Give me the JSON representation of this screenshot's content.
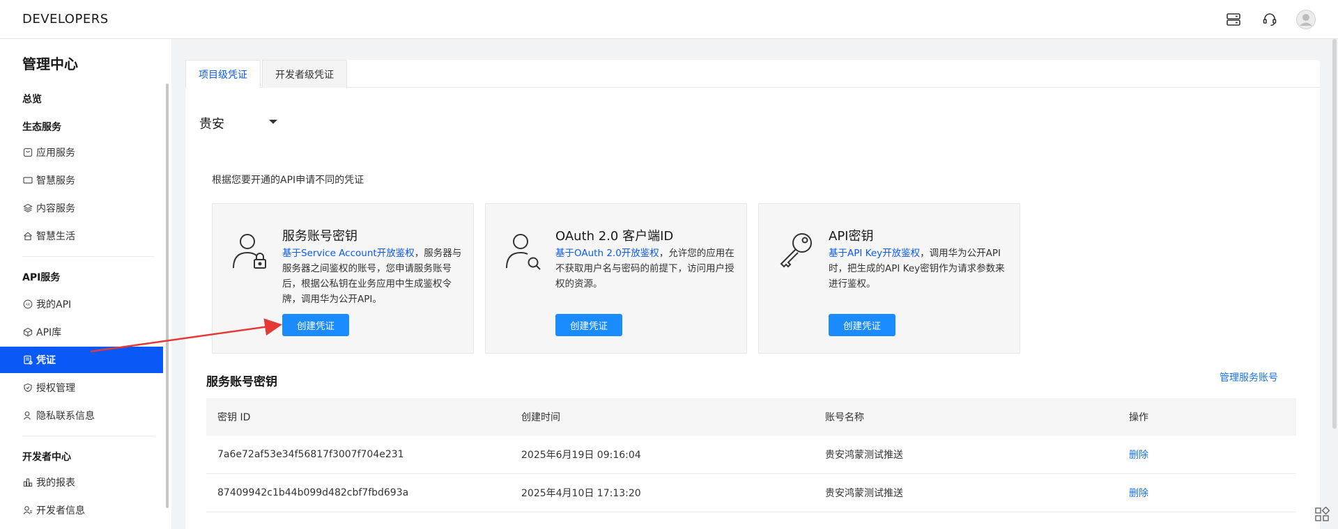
{
  "header": {
    "brand": "DEVELOPERS",
    "icons": [
      "server-icon",
      "headset-icon",
      "user-avatar-icon"
    ]
  },
  "sidebar": {
    "title": "管理中心",
    "overview": "总览",
    "sections": [
      {
        "label": "生态服务",
        "items": [
          {
            "label": "应用服务",
            "icon": "app-service-icon"
          },
          {
            "label": "智慧服务",
            "icon": "smart-service-icon"
          },
          {
            "label": "内容服务",
            "icon": "content-service-icon"
          },
          {
            "label": "智慧生活",
            "icon": "smart-life-icon"
          }
        ]
      },
      {
        "label": "API服务",
        "items": [
          {
            "label": "我的API",
            "icon": "my-api-icon"
          },
          {
            "label": "API库",
            "icon": "api-library-icon"
          },
          {
            "label": "凭证",
            "icon": "credential-icon",
            "active": true
          },
          {
            "label": "授权管理",
            "icon": "authorization-icon"
          },
          {
            "label": "隐私联系信息",
            "icon": "privacy-contact-icon"
          }
        ]
      },
      {
        "label": "开发者中心",
        "items": [
          {
            "label": "我的报表",
            "icon": "report-icon"
          },
          {
            "label": "开发者信息",
            "icon": "developer-info-icon"
          }
        ]
      }
    ]
  },
  "tabs": [
    {
      "label": "项目级凭证",
      "active": true
    },
    {
      "label": "开发者级凭证",
      "active": false
    }
  ],
  "region": {
    "value": "贵安"
  },
  "hint": "根据您要开通的API申请不同的凭证",
  "cards": [
    {
      "title": "服务账号密钥",
      "link": "基于Service Account开放鉴权",
      "desc": "，服务器与服务器之间鉴权的账号，您申请服务账号后，根据公私钥在业务应用中生成鉴权令牌，调用华为公开API。",
      "button": "创建凭证",
      "icon": "user-lock-icon"
    },
    {
      "title": "OAuth 2.0 客户端ID",
      "link": "基于OAuth 2.0开放鉴权",
      "desc": "，允许您的应用在不获取用户名与密码的前提下，访问用户授权的资源。",
      "button": "创建凭证",
      "icon": "user-search-icon"
    },
    {
      "title": "API密钥",
      "link": "基于API Key开放鉴权",
      "desc": "，调用华为公开API时，把生成的API Key密钥作为请求参数来进行鉴权。",
      "button": "创建凭证",
      "icon": "key-icon"
    }
  ],
  "service_accounts": {
    "title": "服务账号密钥",
    "manage_link": "管理服务账号",
    "columns": [
      "密钥 ID",
      "创建时间",
      "账号名称",
      "操作"
    ],
    "rows": [
      {
        "id": "7a6e72af53e34f56817f3007f704e231",
        "created": "2025年6月19日 09:16:04",
        "account": "贵安鸿蒙测试推送",
        "action": "删除"
      },
      {
        "id": "87409942c1b44b099d482cbf7fbd693a",
        "created": "2025年4月10日 17:13:20",
        "account": "贵安鸿蒙测试推送",
        "action": "删除"
      }
    ]
  },
  "colors": {
    "accent": "#0a59f7",
    "button": "#1a8cff",
    "link": "#1a73e8",
    "annotation_arrow": "#e53935"
  }
}
